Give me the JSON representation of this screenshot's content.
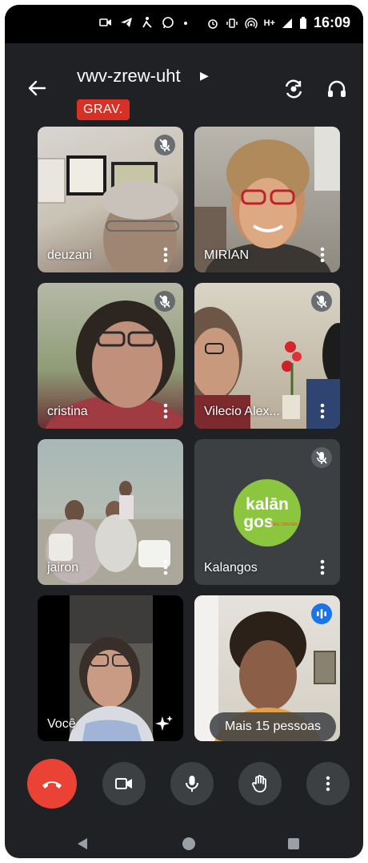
{
  "status_bar": {
    "time": "16:09",
    "network": "H+"
  },
  "header": {
    "meeting_code": "vwv-zrew-uht",
    "recording_label": "GRAV."
  },
  "participants": [
    {
      "name": "deuzani",
      "muted": true
    },
    {
      "name": "MIRIAN",
      "muted": false
    },
    {
      "name": "cristina",
      "muted": true
    },
    {
      "name": "Vilecio Alex...",
      "muted": true
    },
    {
      "name": "jairon",
      "muted": false
    },
    {
      "name": "Kalangos",
      "muted": true,
      "logo_text_top": "kalān",
      "logo_text_bottom": "gos",
      "logo_subtext": "BIKE CENTER"
    },
    {
      "name": "Você",
      "muted": false
    },
    {
      "name": "",
      "muted": false,
      "speaking": true
    }
  ],
  "more_people_label": "Mais 15 pessoas",
  "controls": {
    "end_call": "phone-hangup-icon",
    "camera": "video-camera-icon",
    "mic": "microphone-icon",
    "raise_hand": "hand-icon",
    "more": "more-vert-icon"
  },
  "colors": {
    "end_call_red": "#ea4335",
    "rec_red": "#d93025",
    "background": "#202124",
    "logo_green": "#8cc63f"
  }
}
